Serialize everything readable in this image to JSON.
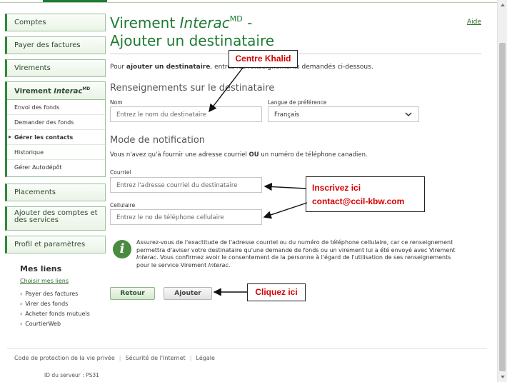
{
  "sidebar": {
    "comptes": "Comptes",
    "payer_factures": "Payer des factures",
    "virements": "Virements",
    "interac_group": {
      "label_prefix": "Virement ",
      "label_italic": "Interac",
      "label_sup": "MD",
      "items": [
        {
          "label": "Envoi des fonds"
        },
        {
          "label": "Demander des fonds"
        },
        {
          "label": "Gérer les contacts"
        },
        {
          "label": "Historique"
        },
        {
          "label": "Gérer Autodépôt"
        }
      ]
    },
    "placements": "Placements",
    "ajouter_comptes": "Ajouter des comptes et des services",
    "profil": "Profil et paramètres",
    "mes_liens": {
      "title": "Mes liens",
      "choisir": "Choisir mes liens",
      "links": [
        "Payer des factures",
        "Virer des fonds",
        "Acheter fonds mutuels",
        "CourtierWeb"
      ]
    }
  },
  "header": {
    "title_prefix": "Virement ",
    "title_italic": "Interac",
    "title_sup": "MD",
    "title_suffix": " -",
    "subtitle": "Ajouter un destinataire",
    "help": "Aide"
  },
  "intro": {
    "pre": "Pour ",
    "bold": "ajouter un destinataire",
    "post": ", entrez les renseignements demandés ci-dessous."
  },
  "recipient": {
    "heading": "Renseignements sur le destinataire",
    "name_label": "Nom",
    "name_placeholder": "Entrez le nom du destinataire",
    "lang_label": "Langue de préférence",
    "lang_value": "Français"
  },
  "notification": {
    "heading": "Mode de notification",
    "note_pre": "Vous n'avez qu'à fournir une adresse courriel ",
    "note_bold": "OU",
    "note_post": " un numéro de téléphone canadien.",
    "email_label": "Courriel",
    "email_placeholder": "Entrez l'adresse courriel du destinataire",
    "phone_label": "Cellulaire",
    "phone_placeholder": "Entrez le no de téléphone cellulaire"
  },
  "info": {
    "icon": "info-icon",
    "line1": "Assurez-vous de l'exactitude de l'adresse courriel ou du numéro de téléphone cellulaire, car ce renseignement",
    "line2": "permettra d'aviser votre destinataire qu'une demande de fonds ou un virement lui a été envoyé avec Virement",
    "line3_italic": "Interac",
    "line3_post": ". Vous confirmez avoir le consentement de la personne à l'égard de l'utilisation de ses renseignements",
    "line4_pre": "pour le service Virement ",
    "line4_italic": "Interac",
    "line4_post": "."
  },
  "buttons": {
    "back": "Retour",
    "add": "Ajouter"
  },
  "footer": {
    "privacy": "Code de protection de la vie privée",
    "security": "Sécurité de l'Internet",
    "legal": "Légale",
    "server": "ID du serveur : PS31"
  },
  "annotations": {
    "name_callout": "Centre Khalid",
    "email_callout_1": "Inscrivez ici",
    "email_callout_2": "contact@ccil-kbw.com",
    "add_callout": "Cliquez  ici"
  },
  "colors": {
    "brand_green": "#1e7b34",
    "annotation_red": "#d40000"
  }
}
